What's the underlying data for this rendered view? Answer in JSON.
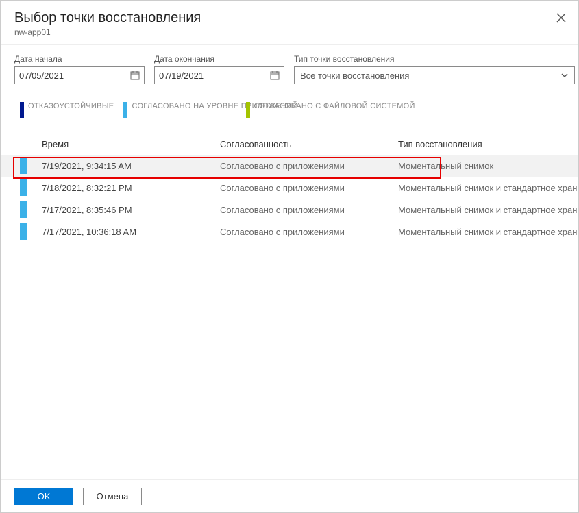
{
  "header": {
    "title": "Выбор точки восстановления",
    "subtitle": "nw-app01"
  },
  "filters": {
    "start_label": "Дата начала",
    "start_value": "07/05/2021",
    "end_label": "Дата окончания",
    "end_value": "07/19/2021",
    "type_label": "Тип точки восстановления",
    "type_value": "Все точки восстановления"
  },
  "legend": {
    "crash": "ОТКАЗОУСТОЙЧИВЫЕ",
    "app": "СОГЛАСОВАНО НА УРОВНЕ ПРИЛОЖЕНИЙ",
    "fs": "СОГЛАСОВАНО С ФАЙЛОВОЙ СИСТЕМОЙ"
  },
  "table": {
    "head_time": "Время",
    "head_cons": "Согласованность",
    "head_type": "Тип восстановления",
    "rows": [
      {
        "time": "7/19/2021, 9:34:15 AM",
        "consistency": "Согласовано с приложениями",
        "type": "Моментальный снимок",
        "selected": true
      },
      {
        "time": "7/18/2021, 8:32:21 PM",
        "consistency": "Согласовано с приложениями",
        "type": "Моментальный снимок и стандартное хранили…",
        "selected": false
      },
      {
        "time": "7/17/2021, 8:35:46 PM",
        "consistency": "Согласовано с приложениями",
        "type": "Моментальный снимок и стандартное хранили…",
        "selected": false
      },
      {
        "time": "7/17/2021, 10:36:18 AM",
        "consistency": "Согласовано с приложениями",
        "type": "Моментальный снимок и стандартное хранили…",
        "selected": false
      }
    ]
  },
  "footer": {
    "ok": "OK",
    "cancel": "Отмена"
  }
}
